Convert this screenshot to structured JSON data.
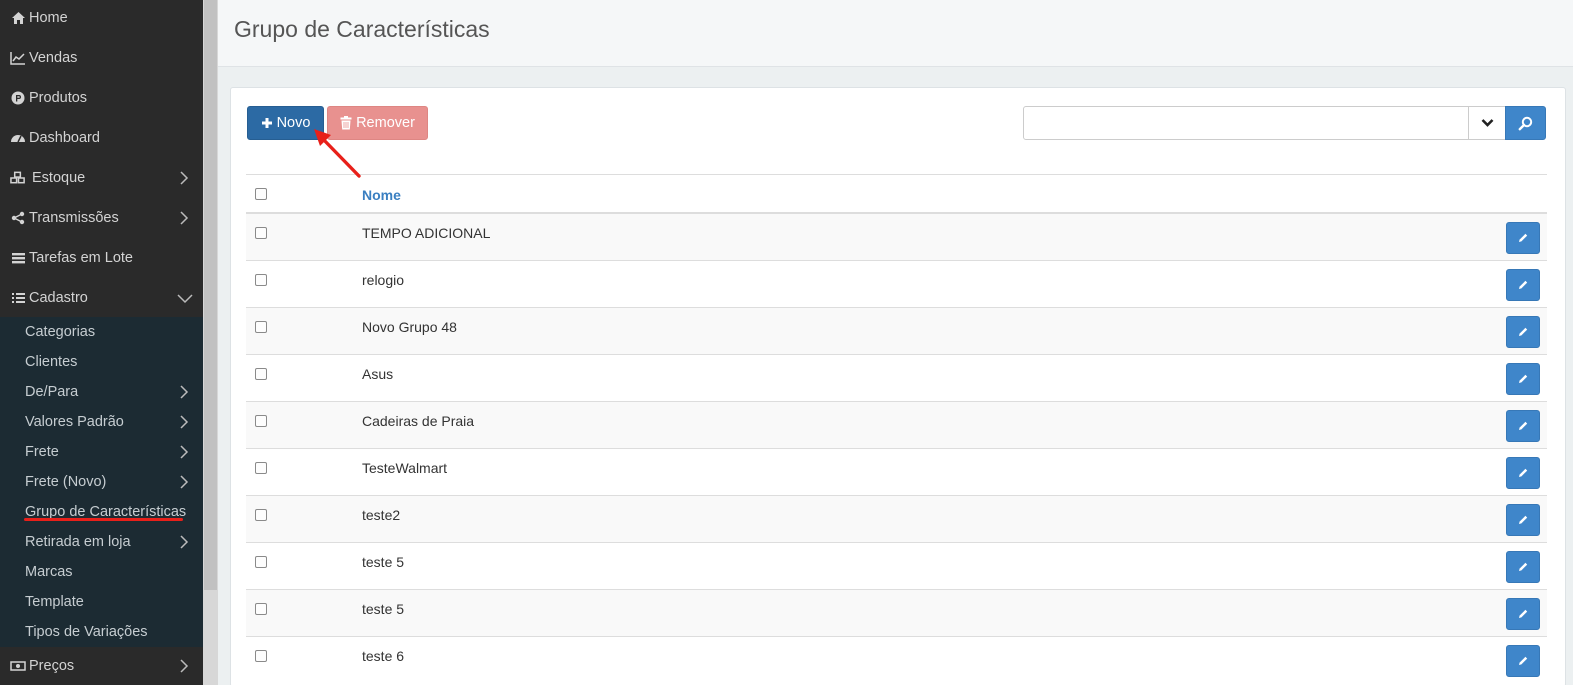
{
  "sidebar": {
    "items": [
      {
        "label": "Home",
        "icon": "home-icon"
      },
      {
        "label": "Vendas",
        "icon": "chart-line-icon"
      },
      {
        "label": "Produtos",
        "icon": "product-p-icon"
      },
      {
        "label": "Dashboard",
        "icon": "dashboard-gauge-icon"
      },
      {
        "label": "Estoque",
        "icon": "cubes-icon"
      },
      {
        "label": "Transmissões",
        "icon": "share-icon"
      },
      {
        "label": "Tarefas em Lote",
        "icon": "tasks-icon"
      },
      {
        "label": "Cadastro",
        "icon": "list-icon"
      }
    ],
    "submenu": [
      {
        "label": "Categorias"
      },
      {
        "label": "Clientes"
      },
      {
        "label": "De/Para"
      },
      {
        "label": "Valores Padrão"
      },
      {
        "label": "Frete"
      },
      {
        "label": "Frete (Novo)"
      },
      {
        "label": "Grupo de Características"
      },
      {
        "label": "Retirada em loja"
      },
      {
        "label": "Marcas"
      },
      {
        "label": "Template"
      },
      {
        "label": "Tipos de Variações"
      }
    ],
    "bottom_item": {
      "label": "Preços",
      "icon": "money-icon"
    }
  },
  "header": {
    "title": "Grupo de Características"
  },
  "toolbar": {
    "novo_label": "Novo",
    "remover_label": "Remover",
    "search_value": "",
    "search_placeholder": ""
  },
  "table": {
    "column_header": "Nome",
    "rows": [
      {
        "name": "TEMPO ADICIONAL"
      },
      {
        "name": "relogio"
      },
      {
        "name": "Novo Grupo 48"
      },
      {
        "name": "Asus"
      },
      {
        "name": "Cadeiras de Praia"
      },
      {
        "name": "TesteWalmart"
      },
      {
        "name": "teste2"
      },
      {
        "name": "teste 5"
      },
      {
        "name": "teste 5"
      },
      {
        "name": "teste 6"
      }
    ]
  },
  "colors": {
    "primary": "#2c6aa4",
    "danger_disabled": "#e8918f",
    "info": "#3f86ca",
    "annotation": "#e8201a"
  }
}
